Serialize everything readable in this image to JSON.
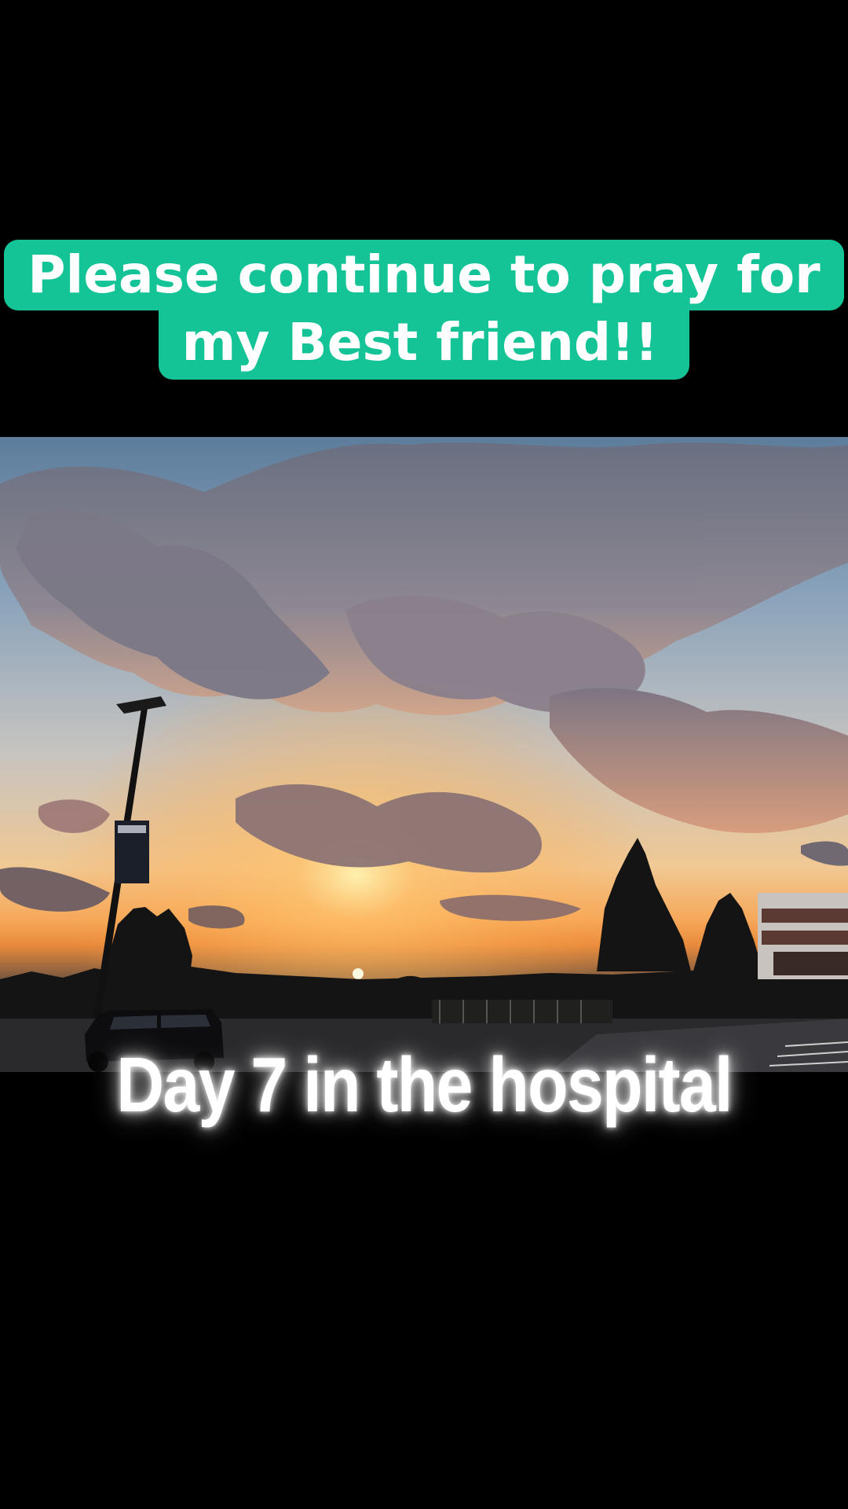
{
  "overlay": {
    "top_caption_line1": "Please continue to pray for",
    "top_caption_line2": "my Best friend!!",
    "bottom_caption": "Day 7 in the hospital"
  },
  "colors": {
    "background": "#000000",
    "caption_box": "#14c496",
    "caption_text": "#ffffff"
  }
}
